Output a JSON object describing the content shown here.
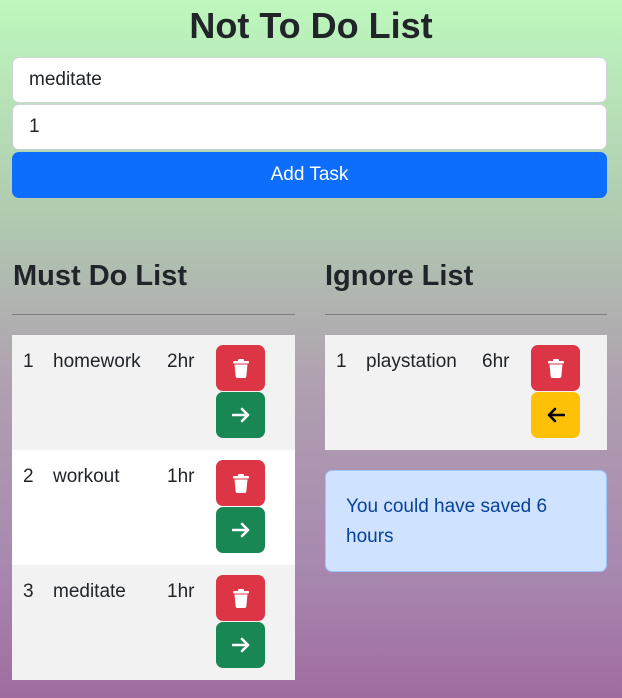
{
  "app": {
    "title": "Not To Do List"
  },
  "form": {
    "task_value": "meditate",
    "hours_value": "1",
    "add_label": "Add Task"
  },
  "must_do": {
    "title": "Must Do List",
    "rows": [
      {
        "num": "1",
        "task": "homework",
        "hours": "2hr"
      },
      {
        "num": "2",
        "task": "workout",
        "hours": "1hr"
      },
      {
        "num": "3",
        "task": "meditate",
        "hours": "1hr"
      }
    ]
  },
  "ignore": {
    "title": "Ignore List",
    "rows": [
      {
        "num": "1",
        "task": "playstation",
        "hours": "6hr"
      }
    ]
  },
  "alert": {
    "text": "You could have saved 6 hours"
  },
  "icons": {
    "delete": "trash-icon",
    "move": "arrow-right-icon",
    "back": "arrow-left-icon"
  },
  "colors": {
    "primary": "#0d6efd",
    "danger": "#dc3545",
    "success": "#198754",
    "warning": "#ffc107",
    "alert_bg": "#cfe2ff"
  }
}
